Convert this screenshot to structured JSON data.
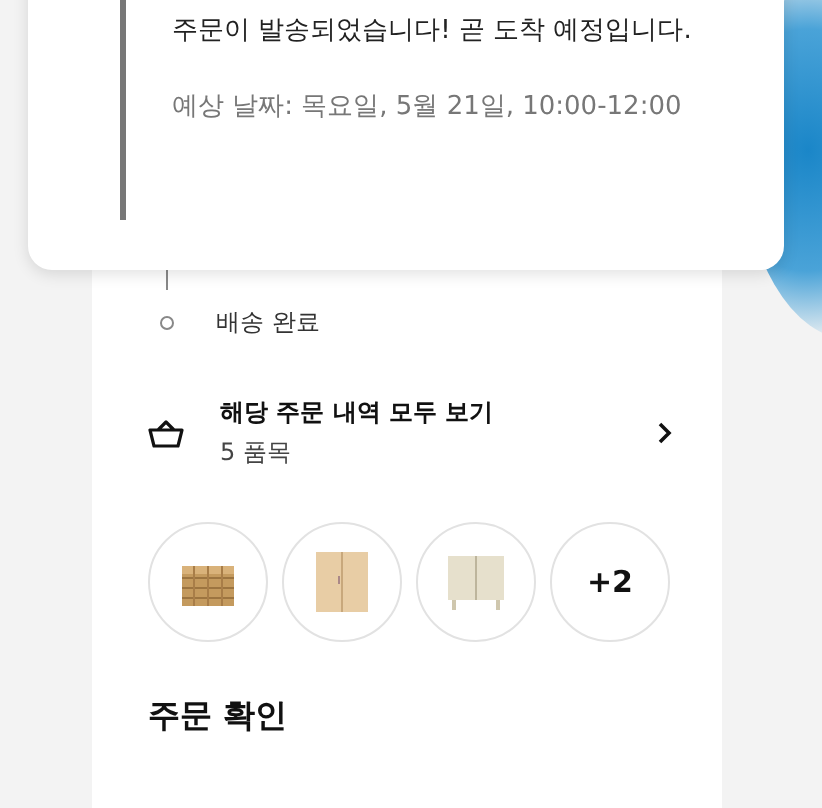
{
  "notice": {
    "message": "주문이 발송되었습니다! 곧 도착 예정입니다.",
    "estimate": "예상 날짜: 목요일, 5월 21일, 10:00-12:00"
  },
  "timeline": [
    {
      "label": "배송 완료",
      "done": false
    }
  ],
  "order_link": {
    "title": "해당 주문 내역 모두 보기",
    "count": "5 품목"
  },
  "thumbnails": [
    {
      "kind": "picture"
    },
    {
      "kind": "picture"
    },
    {
      "kind": "picture"
    },
    {
      "kind": "more",
      "text": "+2"
    }
  ],
  "section_title": "주문 확인"
}
